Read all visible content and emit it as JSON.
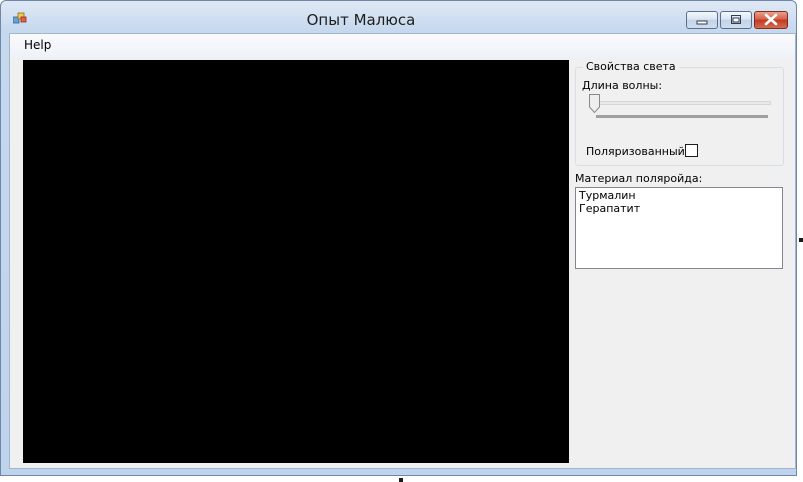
{
  "window": {
    "title": "Опыт Малюса"
  },
  "menu": {
    "items": [
      "Help"
    ]
  },
  "light_properties": {
    "group_label": "Свойства света",
    "wavelength_label": "Длина волны:",
    "wavelength_slider_level": 0,
    "polarized_label": "Поляризованный:",
    "polarized_checked": false
  },
  "polaroid": {
    "label": "Материал поляройда:",
    "materials": [
      "Турмалин",
      "Герапатит"
    ]
  },
  "icons": {
    "app": "window-app-icon",
    "minimize": "minimize-icon",
    "maximize": "maximize-icon",
    "close": "close-icon"
  },
  "colors": {
    "canvas": "#000000",
    "close_button": "#c4391f"
  }
}
